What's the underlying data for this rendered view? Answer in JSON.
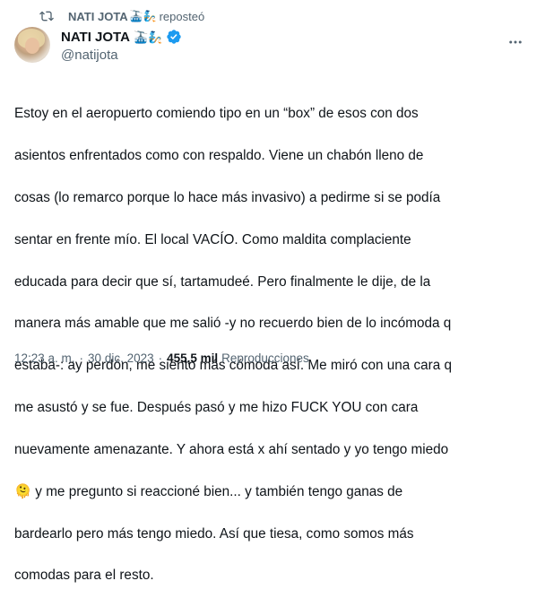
{
  "repost": {
    "user": "NATI JOTA",
    "emojis": "🚠🧞",
    "verb": "reposteó"
  },
  "author": {
    "display_name": "NATI JOTA",
    "emojis": "🚠🧞",
    "handle": "@natijota"
  },
  "tweet": {
    "lines": [
      "Estoy en el aeropuerto comiendo tipo en un “box” de esos con dos",
      "asientos enfrentados como con respaldo. Viene un chabón lleno de",
      "cosas (lo remarco porque lo hace más invasivo) a pedirme si se podía",
      "sentar en frente mío. El local VACÍO. Como maldita complaciente",
      "educada para decir que sí, tartamudeé. Pero finalmente le dije, de la",
      "manera más amable que me salió -y no recuerdo bien de lo incómoda q",
      "estaba-: ay perdón, me siento más cómoda así. Me miró con una cara q",
      "me asustó y se fue. Después pasó y me hizo FUCK YOU con cara",
      "nuevamente amenazante. Y ahora está x ahí sentado y yo tengo miedo",
      "🫠 y me pregunto si reaccioné bien... y también tengo ganas de",
      "bardearlo pero más tengo miedo. Así que tiesa, como somos más",
      "comodas para el resto."
    ]
  },
  "meta": {
    "time": "12:23 a. m.",
    "separator": "·",
    "date": "30 dic. 2023",
    "views": "455,5 mil",
    "views_label": "Reproducciones"
  },
  "colors": {
    "text": "#0f1419",
    "secondary": "#536471",
    "verified": "#1d9bf0"
  },
  "icons": {
    "repost": "repost-icon",
    "verified": "verified-badge-icon",
    "more": "more-dots-icon"
  }
}
